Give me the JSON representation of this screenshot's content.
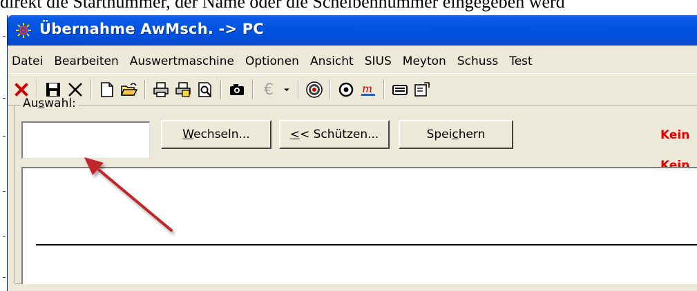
{
  "doc": {
    "text_above": "direkt die Startnummer, der Name oder die Scheibennummer eingegeben werd"
  },
  "window": {
    "title": "Übernahme AwMsch. -> PC",
    "title_icon": "red-target-icon"
  },
  "menubar": {
    "items": [
      "Datei",
      "Bearbeiten",
      "Auswertmaschine",
      "Optionen",
      "Ansicht",
      "SIUS",
      "Meyton",
      "Schuss",
      "Test"
    ]
  },
  "toolbar": {
    "icons": [
      "close-red-icon",
      "save-icon",
      "delete-icon",
      "new-document-icon",
      "open-folder-icon",
      "print-icon",
      "print-setup-icon",
      "print-preview-icon",
      "camera-icon",
      "euro-icon",
      "dropdown-arrow-icon",
      "target-icon",
      "bullseye-icon",
      "meyton-logo-icon",
      "printer-icon",
      "properties-icon"
    ],
    "euro_symbol": "€"
  },
  "auswahl": {
    "label_pre": "Au",
    "label_mnemonic": "s",
    "label_post": "wahl:",
    "input_value": "",
    "buttons": {
      "wechseln": {
        "mnemonic": "W",
        "rest": "echseln..."
      },
      "schuetzen": {
        "pre": "",
        "mnemonic": "<",
        "rest": "< Schützen..."
      },
      "speichern": {
        "pre": "Spei",
        "mnemonic": "c",
        "rest": "hern"
      }
    },
    "status_line1": "Kein",
    "status_line2": "Kein"
  },
  "colors": {
    "titlebar": "#0054e3",
    "window_bg": "#ece9d8",
    "status_text": "#e00000",
    "annotation_arrow": "#c0282a"
  }
}
